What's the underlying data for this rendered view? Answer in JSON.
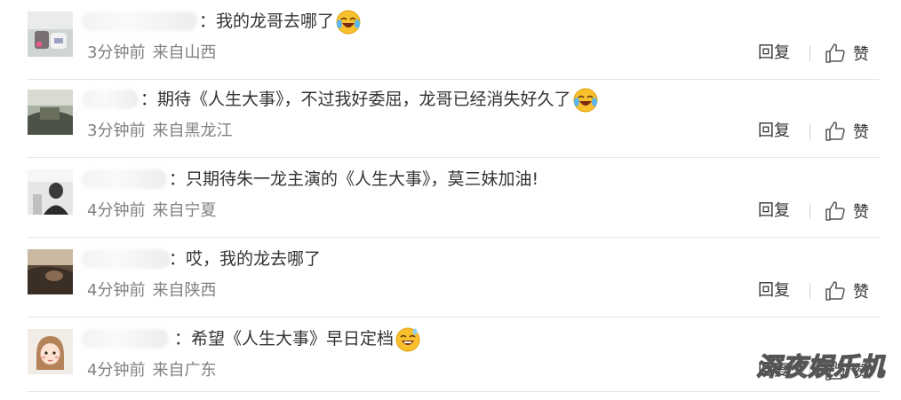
{
  "comments": [
    {
      "text": "：我的龙哥去哪了",
      "emoji": "laugh-cry-emoji",
      "time": "3分钟前",
      "location": "来自山西",
      "reply_label": "回复",
      "like_label": "赞"
    },
    {
      "text": "：期待《人生大事》，不过我好委屈，龙哥已经消失好久了",
      "emoji": "laugh-cry-emoji",
      "time": "3分钟前",
      "location": "来自黑龙江",
      "reply_label": "回复",
      "like_label": "赞"
    },
    {
      "text": "：只期待朱一龙主演的《人生大事》，莫三妹加油!",
      "emoji": "",
      "time": "4分钟前",
      "location": "来自宁夏",
      "reply_label": "回复",
      "like_label": "赞"
    },
    {
      "text": "：哎，我的龙去哪了",
      "emoji": "",
      "time": "4分钟前",
      "location": "来自陕西",
      "reply_label": "回复",
      "like_label": "赞"
    },
    {
      "text": "：希望《人生大事》早日定档",
      "emoji": "grin-sweat-emoji",
      "time": "4分钟前",
      "location": "来自广东",
      "reply_label": "回复",
      "like_label": "赞"
    }
  ],
  "watermark": "深夜娱乐机",
  "colors": {
    "text": "#333333",
    "meta": "#808080",
    "divider": "#e5e5e5",
    "emoji_yellow": "#f7c02c"
  }
}
